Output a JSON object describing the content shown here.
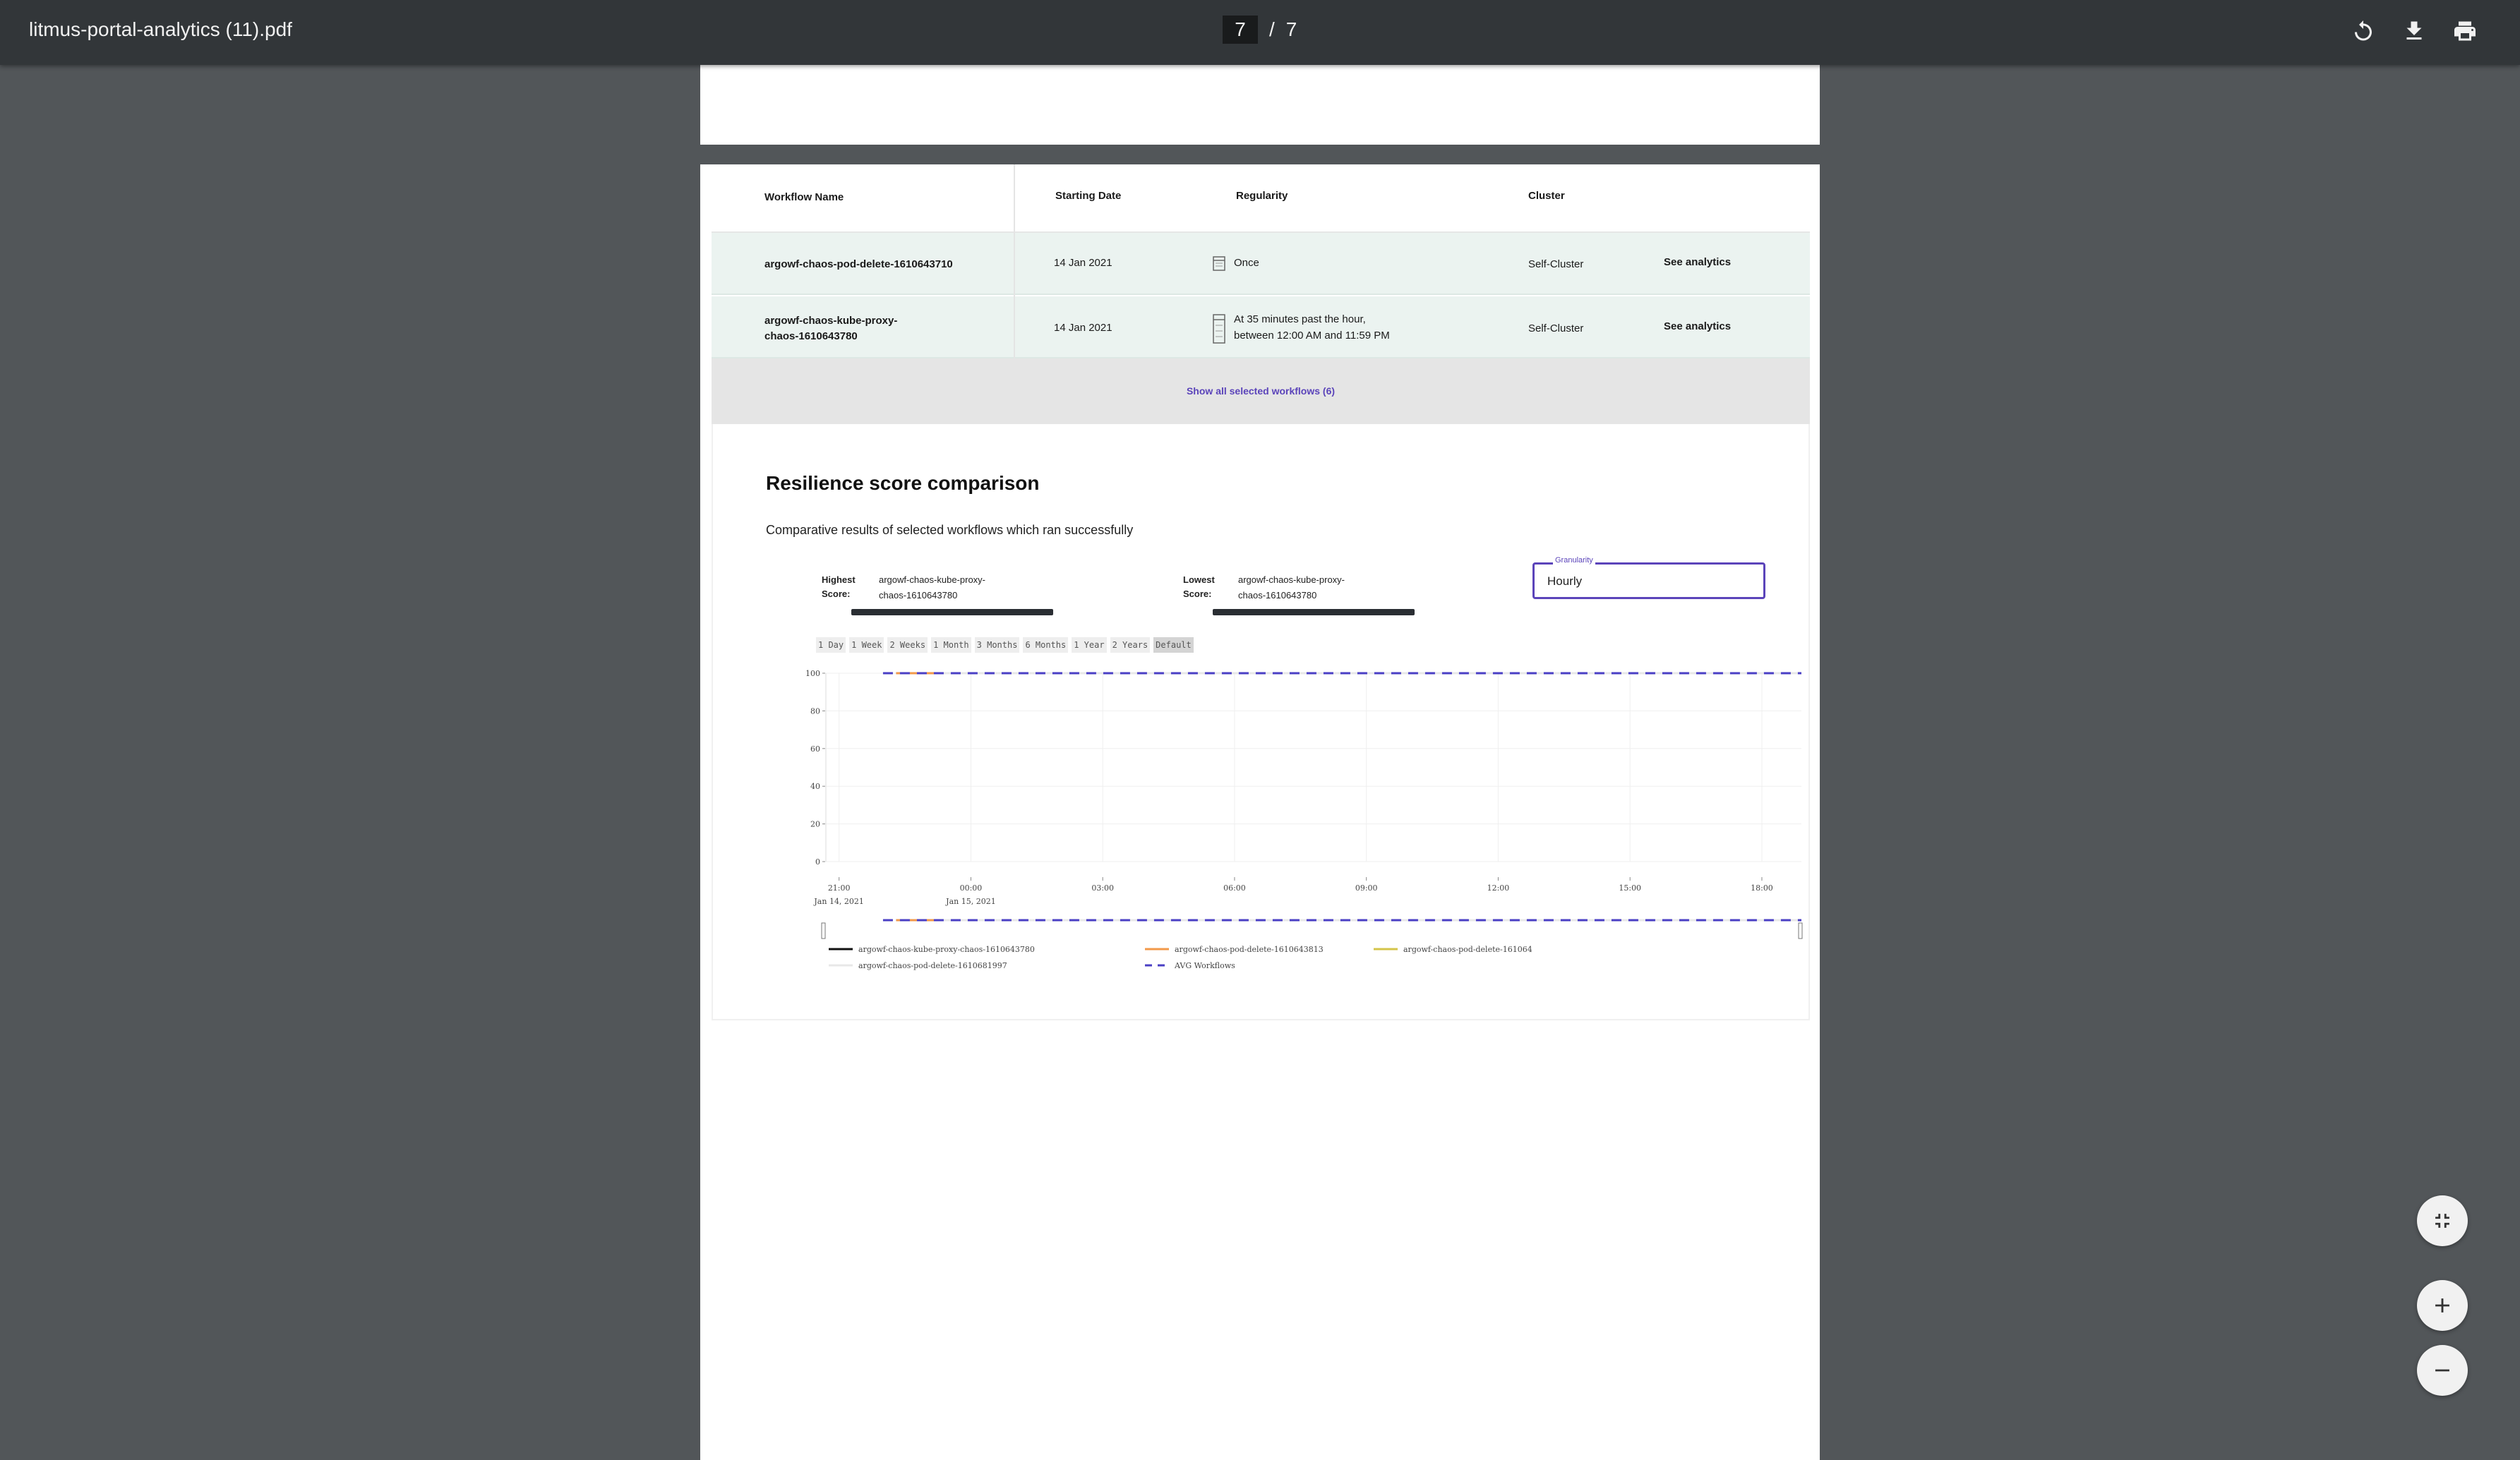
{
  "viewer": {
    "file_name": "litmus-portal-analytics (11).pdf",
    "current_page": "7",
    "page_separator": "/",
    "total_pages": "7"
  },
  "toolbar_icons": [
    "rotate-icon",
    "download-icon",
    "print-icon"
  ],
  "table": {
    "headers": {
      "workflow_name": "Workflow Name",
      "starting_date": "Starting Date",
      "regularity": "Regularity",
      "cluster": "Cluster"
    },
    "rows": [
      {
        "name_line1": "argowf-chaos-pod-delete-1610643710",
        "name_line2": "",
        "date": "14 Jan 2021",
        "regularity_line1": "Once",
        "regularity_line2": "",
        "cluster": "Self-Cluster",
        "action": "See analytics"
      },
      {
        "name_line1": "argowf-chaos-kube-proxy-",
        "name_line2": "chaos-1610643780",
        "date": "14 Jan 2021",
        "regularity_line1": "At 35 minutes past the hour,",
        "regularity_line2": "between 12:00 AM and 11:59 PM",
        "cluster": "Self-Cluster",
        "action": "See analytics"
      }
    ],
    "show_all": "Show all selected workflows (6)"
  },
  "resilience": {
    "title": "Resilience score comparison",
    "subtitle": "Comparative results of selected workflows which ran successfully",
    "highest": {
      "label_1": "Highest",
      "label_2": "Score:",
      "value_1": "argowf-chaos-kube-proxy-",
      "value_2": "chaos-1610643780"
    },
    "lowest": {
      "label_1": "Lowest",
      "label_2": "Score:",
      "value_1": "argowf-chaos-kube-proxy-",
      "value_2": "chaos-1610643780"
    },
    "granularity_label": "Granularity",
    "granularity_value": "Hourly",
    "range_buttons": [
      "1 Day",
      "1 Week",
      "2 Weeks",
      "1 Month",
      "3 Months",
      "6 Months",
      "1 Year",
      "2 Years",
      "Default"
    ],
    "active_range": "Default"
  },
  "chart_data": {
    "type": "line",
    "title": "",
    "ylim": [
      0,
      100
    ],
    "y_ticks": [
      0,
      20,
      40,
      60,
      80,
      100
    ],
    "x_ticks": [
      {
        "label": "21:00",
        "sub": "Jan 14, 2021"
      },
      {
        "label": "00:00",
        "sub": "Jan 15, 2021"
      },
      {
        "label": "03:00",
        "sub": ""
      },
      {
        "label": "06:00",
        "sub": ""
      },
      {
        "label": "09:00",
        "sub": ""
      },
      {
        "label": "12:00",
        "sub": ""
      },
      {
        "label": "15:00",
        "sub": ""
      },
      {
        "label": "18:00",
        "sub": ""
      }
    ],
    "x_hours_range": [
      -0.3,
      21.9
    ],
    "series": [
      {
        "name": "argowf-chaos-kube-proxy-chaos-1610643780",
        "color": "#111111",
        "dash": false,
        "points": [
          [
            1.3,
            100
          ],
          [
            2.2,
            100
          ],
          [
            10.9,
            100
          ],
          [
            21.9,
            100
          ]
        ]
      },
      {
        "name": "argowf-chaos-pod-delete-1610643813",
        "color": "#f2994a",
        "dash": false,
        "points": [
          [
            1.3,
            100
          ],
          [
            21.9,
            100
          ]
        ]
      },
      {
        "name": "argowf-chaos-pod-delete-161064",
        "color": "#d4c44a",
        "dash": false,
        "points": [
          [
            2.2,
            100
          ],
          [
            21.9,
            100
          ]
        ]
      },
      {
        "name": "argowf-chaos-pod-delete-1610681997",
        "color": "#e8e8e8",
        "dash": false,
        "points": [
          [
            2.2,
            100
          ],
          [
            21.9,
            100
          ]
        ]
      },
      {
        "name": "AVG Workflows",
        "color": "#4a3fc4",
        "dash": true,
        "points": [
          [
            1.0,
            100
          ],
          [
            21.9,
            100
          ]
        ]
      }
    ],
    "legend": [
      {
        "label": "argowf-chaos-kube-proxy-chaos-1610643780",
        "color": "#111111",
        "dash": false
      },
      {
        "label": "argowf-chaos-pod-delete-1610643813",
        "color": "#f2994a",
        "dash": false
      },
      {
        "label": "argowf-chaos-pod-delete-161064",
        "color": "#d4c44a",
        "dash": false
      },
      {
        "label": "argowf-chaos-pod-delete-1610681997",
        "color": "#e8e8e8",
        "dash": false
      },
      {
        "label": "AVG Workflows",
        "color": "#4a3fc4",
        "dash": true
      }
    ]
  },
  "fabs": [
    "fit-page-icon",
    "zoom-in-icon",
    "zoom-out-icon"
  ]
}
